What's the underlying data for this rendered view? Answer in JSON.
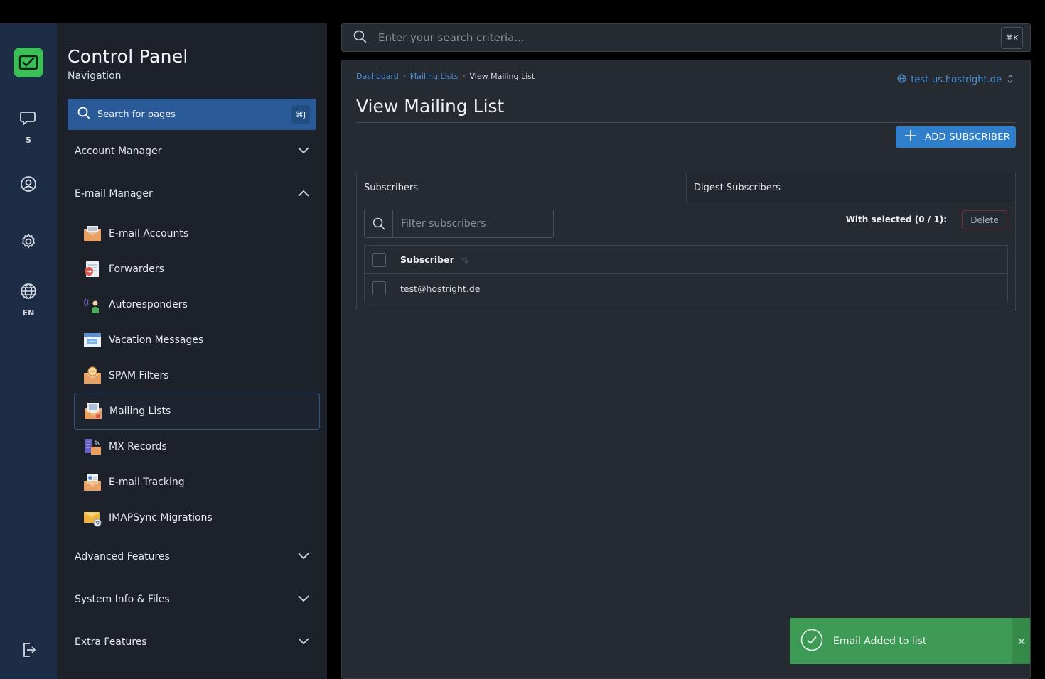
{
  "rail": {
    "messages_count": "5",
    "language": "EN",
    "icons": [
      "app-logo-icon",
      "chat-icon",
      "user-icon",
      "gear-icon",
      "globe-icon",
      "logout-icon"
    ]
  },
  "nav": {
    "title": "Control Panel",
    "subtitle": "Navigation",
    "search_label": "Search for pages",
    "search_shortcut": "⌘J",
    "sections": [
      {
        "label": "Account Manager",
        "expanded": false
      },
      {
        "label": "E-mail Manager",
        "expanded": true
      },
      {
        "label": "Advanced Features",
        "expanded": false
      },
      {
        "label": "System Info & Files",
        "expanded": false
      },
      {
        "label": "Extra Features",
        "expanded": false
      }
    ],
    "email_items": [
      {
        "label": "E-mail Accounts",
        "icon": "email-accounts-icon"
      },
      {
        "label": "Forwarders",
        "icon": "forwarders-icon"
      },
      {
        "label": "Autoresponders",
        "icon": "autoresponders-icon"
      },
      {
        "label": "Vacation Messages",
        "icon": "vacation-messages-icon"
      },
      {
        "label": "SPAM Filters",
        "icon": "spam-filters-icon"
      },
      {
        "label": "Mailing Lists",
        "icon": "mailing-lists-icon",
        "active": true
      },
      {
        "label": "MX Records",
        "icon": "mx-records-icon"
      },
      {
        "label": "E-mail Tracking",
        "icon": "email-tracking-icon"
      },
      {
        "label": "IMAPSync Migrations",
        "icon": "imapsync-icon"
      }
    ]
  },
  "search": {
    "placeholder": "Enter your search criteria...",
    "shortcut": "⌘K"
  },
  "main": {
    "breadcrumb": [
      "Dashboard",
      "Mailing Lists",
      "View Mailing List"
    ],
    "domain": "test-us.hostright.de",
    "title": "View Mailing List",
    "add_button": "ADD SUBSCRIBER",
    "tabs": [
      "Subscribers",
      "Digest Subscribers"
    ],
    "filter_placeholder": "Filter subscribers",
    "with_selected": "With selected (0 / 1):",
    "delete_button": "Delete",
    "table": {
      "header": "Subscriber",
      "rows": [
        "test@hostright.de"
      ]
    }
  },
  "toast": {
    "message": "Email Added to list"
  },
  "colors": {
    "rail_bg": "#1c2d45",
    "nav_bg": "#1d212a",
    "content_bg": "#262a31",
    "accent": "#2f7fcd",
    "link": "#4a90d9",
    "success": "#3e9b55",
    "logo": "#3fbf5a"
  }
}
